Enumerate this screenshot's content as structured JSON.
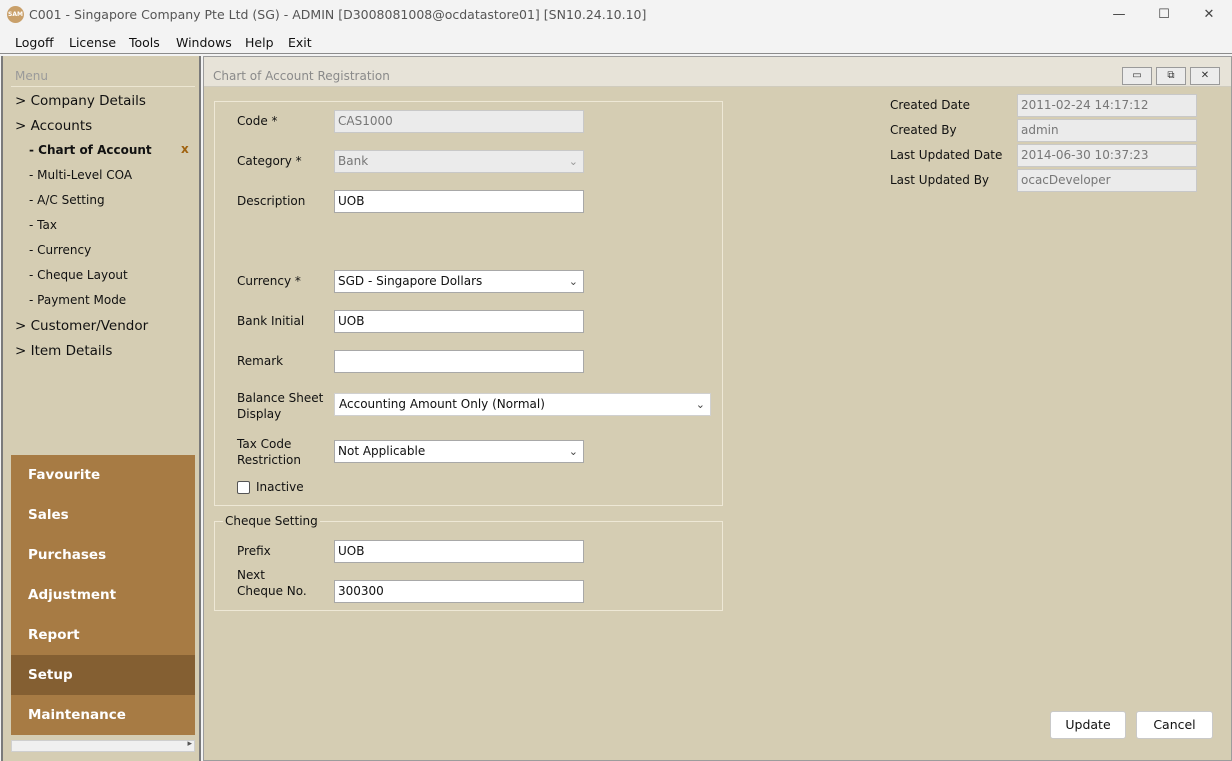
{
  "window": {
    "app_icon_text": "SAM",
    "title": "C001 - Singapore Company Pte Ltd (SG) - ADMIN [D3008081008@ocdatastore01] [SN10.24.10.10]",
    "minimize": "—",
    "maximize": "☐",
    "close": "✕"
  },
  "menubar": [
    "Logoff",
    "License",
    "Tools",
    "Windows",
    "Help",
    "Exit"
  ],
  "sidebar": {
    "caption": "Menu",
    "tree": [
      {
        "label": "> Company Details"
      },
      {
        "label": "> Accounts"
      },
      {
        "label": "- Chart of Account"
      },
      {
        "label": "- Multi-Level COA"
      },
      {
        "label": "- A/C Setting"
      },
      {
        "label": "- Tax"
      },
      {
        "label": "- Currency"
      },
      {
        "label": "- Cheque Layout"
      },
      {
        "label": "- Payment Mode"
      },
      {
        "label": "> Customer/Vendor"
      },
      {
        "label": "> Item Details"
      }
    ],
    "close_mark": "x",
    "nav": [
      "Favourite",
      "Sales",
      "Purchases",
      "Adjustment",
      "Report",
      "Setup",
      "Maintenance"
    ],
    "active_nav": "Setup"
  },
  "form": {
    "title": "Chart of Account Registration",
    "mdi_buttons": [
      "▭",
      "⧉",
      "✕"
    ],
    "code": {
      "label": "Code *",
      "value": "CAS1000"
    },
    "category": {
      "label": "Category *",
      "value": "Bank"
    },
    "description": {
      "label": "Description",
      "value": "UOB"
    },
    "currency": {
      "label": "Currency *",
      "value": "SGD - Singapore Dollars"
    },
    "bank_initial": {
      "label": "Bank Initial",
      "value": "UOB"
    },
    "remark": {
      "label": "Remark",
      "value": ""
    },
    "balance_sheet": {
      "label_line1": "Balance Sheet",
      "label_line2": "Display",
      "value": "Accounting Amount Only (Normal)"
    },
    "tax_code": {
      "label_line1": "Tax Code",
      "label_line2": "Restriction",
      "value": "Not Applicable"
    },
    "inactive": {
      "label": "Inactive",
      "checked": false
    },
    "cheque": {
      "title": "Cheque Setting",
      "prefix": {
        "label": "Prefix",
        "value": "UOB"
      },
      "next": {
        "label_line1": "Next",
        "label_line2": "Cheque No.",
        "value": "300300"
      }
    },
    "audit": {
      "created_date": {
        "label": "Created Date",
        "value": "2011-02-24 14:17:12"
      },
      "created_by": {
        "label": "Created By",
        "value": "admin"
      },
      "updated_date": {
        "label": "Last Updated Date",
        "value": "2014-06-30 10:37:23"
      },
      "updated_by": {
        "label": "Last Updated By",
        "value": "ocacDeveloper"
      }
    },
    "update_label": "Update",
    "cancel_label": "Cancel"
  }
}
